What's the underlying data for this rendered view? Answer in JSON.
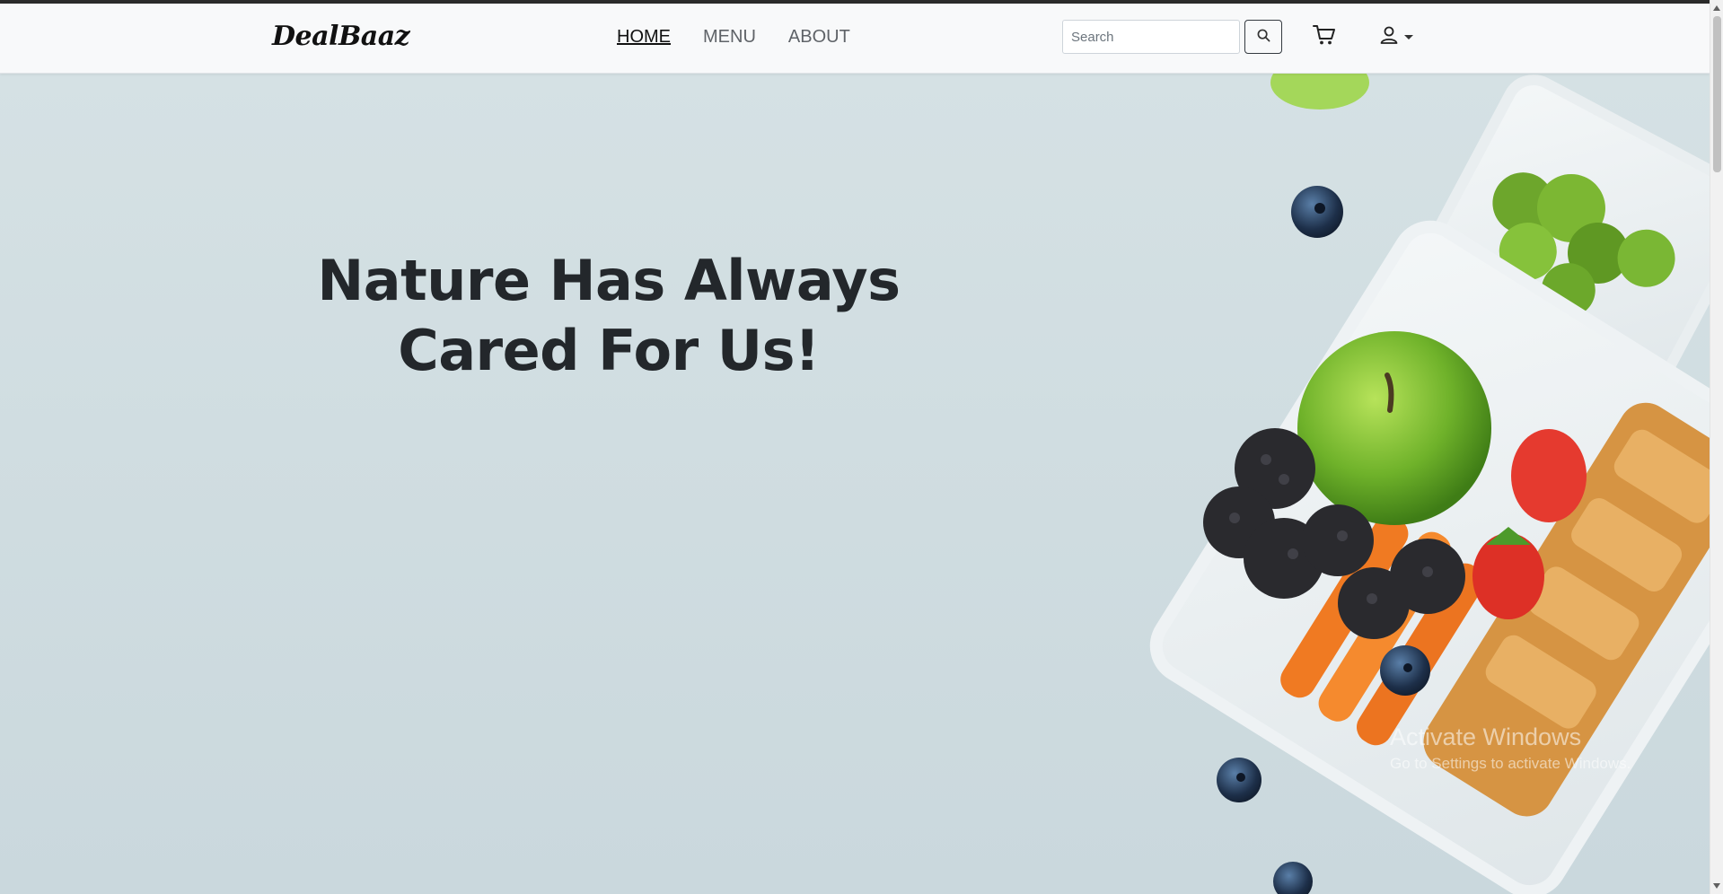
{
  "navbar": {
    "brand": "DealBaaz",
    "links": [
      {
        "label": "HOME",
        "active": true
      },
      {
        "label": "MENU",
        "active": false
      },
      {
        "label": "ABOUT",
        "active": false
      }
    ],
    "search": {
      "placeholder": "Search",
      "value": ""
    },
    "icons": {
      "search": "search-icon",
      "cart": "cart-icon",
      "user": "user-icon",
      "caret": "caret-down-icon"
    }
  },
  "hero": {
    "title_line1": "Nature Has Always",
    "title_line2": "Cared For Us!"
  },
  "watermark": {
    "title": "Activate Windows",
    "subtitle": "Go to Settings to activate Windows."
  },
  "colors": {
    "navbar_bg": "#f8f9fa",
    "hero_bg": "#cfdde1",
    "title_text": "#23272b"
  }
}
